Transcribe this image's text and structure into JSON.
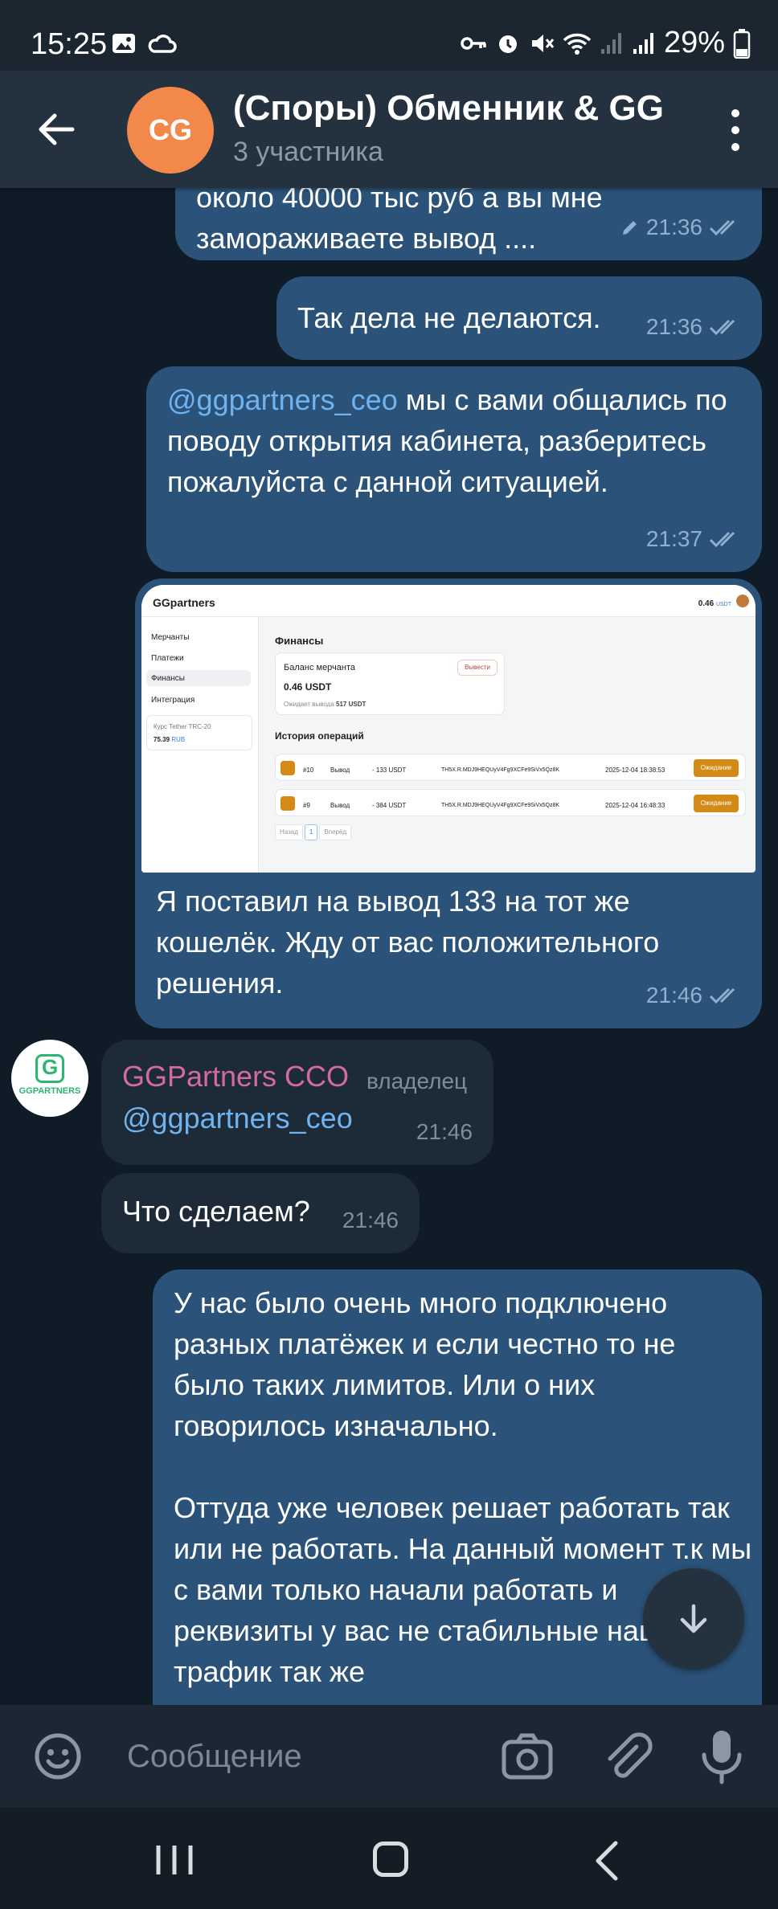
{
  "status_bar": {
    "time": "15:25",
    "battery": "29%"
  },
  "header": {
    "avatar_initials": "CG",
    "title": "(Споры) Обменник & GG",
    "subtitle": "3 участника"
  },
  "messages": [
    {
      "type": "out",
      "lines": [
        "около 40000 тыс руб а вы мне",
        "замораживаете вывод ...."
      ],
      "time": "21:36",
      "edited": true
    },
    {
      "type": "out",
      "text": "Так дела не делаются.",
      "time": "21:36"
    },
    {
      "type": "out",
      "mention": "@ggpartners_ceo",
      "text": " мы с вами общались по поводу открытия кабинета, разберитесь пожалуйста с данной ситуацией.",
      "time": "21:37"
    },
    {
      "type": "out_photo",
      "text": "Я поставил на вывод 133 на тот же кошелёк.  Жду от вас положительного решения.",
      "time": "21:46"
    },
    {
      "type": "in",
      "sender": "GGPartners CCO",
      "role": "владелец",
      "text": "@ggpartners_ceo",
      "time": "21:46"
    },
    {
      "type": "in",
      "text": "Что сделаем?",
      "time": "21:46"
    },
    {
      "type": "out",
      "para1": "У нас было очень много подключено разных платёжек и если честно то не было таких лимитов. Или о них говорилось изначально.",
      "para2": " Оттуда уже человек решает работать так или не работать. На данный момент т.к мы с вами только начали работать и реквизиты у вас не стабильные наш трафик так же"
    }
  ],
  "screenshot": {
    "logo": "GGpartners",
    "balance_top": "0.46",
    "balance_top_unit": "USDT",
    "nav": [
      "Мерчанты",
      "Платежи",
      "Финансы",
      "Интеграция"
    ],
    "rate_label": "Курс Tether TRC-20",
    "rate_value": "75.39",
    "rate_unit": "RUB",
    "section_title": "Финансы",
    "card_title": "Баланс мерчанта",
    "card_button": "Вывести",
    "card_balance": "0.46 USDT",
    "card_pending": "Ожидает вывода",
    "card_pending_value": "517 USDT",
    "history_title": "История операций",
    "rows": [
      {
        "id": "#10",
        "type": "Вывод",
        "amount": "- 133 USDT",
        "wallet": "TH5X.R.MDJ9HEQUyV4Fg9XCFe9SiVx5Qz8K",
        "date": "2025-12-04 18:38:53",
        "status": "Ожидание"
      },
      {
        "id": "#9",
        "type": "Вывод",
        "amount": "- 384 USDT",
        "wallet": "TH5X.R.MDJ9HEQUyV4Fg9XCFe9SiVx5Qz8K",
        "date": "2025-12-04 16:48:33",
        "status": "Ожидание"
      }
    ],
    "pager": [
      "Назад",
      "1",
      "Вперёд"
    ]
  },
  "composer": {
    "placeholder": "Сообщение"
  },
  "icons": {
    "back": "arrow-left-icon",
    "menu": "more-vertical-icon",
    "emoji": "emoji-icon",
    "camera": "camera-icon",
    "attach": "paperclip-icon",
    "mic": "microphone-icon",
    "scroll_down": "arrow-down-icon"
  }
}
